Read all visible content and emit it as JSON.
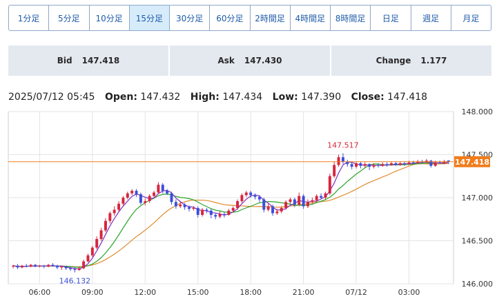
{
  "timeframes": [
    {
      "label": "1分足",
      "active": false
    },
    {
      "label": "5分足",
      "active": false
    },
    {
      "label": "10分足",
      "active": false
    },
    {
      "label": "15分足",
      "active": true
    },
    {
      "label": "30分足",
      "active": false
    },
    {
      "label": "60分足",
      "active": false
    },
    {
      "label": "2時間足",
      "active": false
    },
    {
      "label": "4時間足",
      "active": false
    },
    {
      "label": "8時間足",
      "active": false
    },
    {
      "label": "日足",
      "active": false
    },
    {
      "label": "週足",
      "active": false
    },
    {
      "label": "月足",
      "active": false
    }
  ],
  "quote": {
    "bid_label": "Bid",
    "bid_value": "147.418",
    "ask_label": "Ask",
    "ask_value": "147.430",
    "change_label": "Change",
    "change_value": "1.177"
  },
  "ohlc": {
    "datetime": "2025/07/12 05:45",
    "open_label": "Open:",
    "open": "147.432",
    "high_label": "High:",
    "high": "147.434",
    "low_label": "Low:",
    "low": "147.390",
    "close_label": "Close:",
    "close": "147.418"
  },
  "colors": {
    "up": "#d7263d",
    "down": "#3b4fd8",
    "ma_fast": "#7b2fbf",
    "ma_mid": "#2aa52a",
    "ma_slow": "#e0892b",
    "current_price_bg": "#f07d1c",
    "grid": "#e3e3e3"
  },
  "chart_data": {
    "type": "candlestick",
    "ylim": [
      146.0,
      148.0
    ],
    "y_ticks": [
      "148.000",
      "147.500",
      "147.000",
      "146.500",
      "146.000"
    ],
    "y_tick_values": [
      148.0,
      147.5,
      147.0,
      146.5,
      146.0
    ],
    "x_ticks": [
      "06:00",
      "09:00",
      "12:00",
      "15:00",
      "18:00",
      "21:00",
      "07/12",
      "03:00"
    ],
    "x_tick_index": [
      6,
      18,
      30,
      42,
      54,
      66,
      78,
      90
    ],
    "current_price": 147.418,
    "current_price_label": "147.418",
    "annotations": [
      {
        "text": "147.517",
        "index": 75,
        "value": 147.517,
        "pos": "above"
      },
      {
        "text": "146.132",
        "index": 14,
        "value": 146.132,
        "pos": "below"
      }
    ],
    "candles": [
      [
        146.2,
        146.21,
        146.22,
        146.18
      ],
      [
        146.21,
        146.19,
        146.23,
        146.17
      ],
      [
        146.19,
        146.21,
        146.22,
        146.18
      ],
      [
        146.21,
        146.2,
        146.23,
        146.19
      ],
      [
        146.2,
        146.22,
        146.23,
        146.19
      ],
      [
        146.22,
        146.2,
        146.23,
        146.19
      ],
      [
        146.2,
        146.21,
        146.22,
        146.19
      ],
      [
        146.21,
        146.2,
        146.22,
        146.18
      ],
      [
        146.2,
        146.22,
        146.23,
        146.19
      ],
      [
        146.22,
        146.21,
        146.24,
        146.2
      ],
      [
        146.21,
        146.19,
        146.22,
        146.17
      ],
      [
        146.19,
        146.2,
        146.21,
        146.16
      ],
      [
        146.2,
        146.18,
        146.21,
        146.16
      ],
      [
        146.18,
        146.17,
        146.2,
        146.15
      ],
      [
        146.17,
        146.16,
        146.19,
        146.132
      ],
      [
        146.16,
        146.18,
        146.2,
        146.15
      ],
      [
        146.18,
        146.26,
        146.28,
        146.17
      ],
      [
        146.26,
        146.33,
        146.35,
        146.25
      ],
      [
        146.33,
        146.42,
        146.44,
        146.31
      ],
      [
        146.42,
        146.52,
        146.55,
        146.4
      ],
      [
        146.52,
        146.62,
        146.65,
        146.5
      ],
      [
        146.62,
        146.73,
        146.76,
        146.6
      ],
      [
        146.73,
        146.82,
        146.84,
        146.7
      ],
      [
        146.82,
        146.86,
        146.9,
        146.79
      ],
      [
        146.86,
        146.93,
        146.96,
        146.84
      ],
      [
        146.93,
        147.0,
        147.02,
        146.91
      ],
      [
        147.0,
        147.05,
        147.07,
        146.98
      ],
      [
        147.05,
        147.08,
        147.1,
        147.03
      ],
      [
        147.08,
        147.04,
        147.1,
        147.01
      ],
      [
        147.04,
        146.94,
        147.06,
        146.92
      ],
      [
        146.94,
        146.96,
        146.99,
        146.91
      ],
      [
        146.96,
        147.02,
        147.04,
        146.94
      ],
      [
        147.02,
        147.06,
        147.08,
        147.0
      ],
      [
        147.06,
        147.15,
        147.18,
        147.04
      ],
      [
        147.15,
        147.08,
        147.17,
        147.05
      ],
      [
        147.08,
        147.05,
        147.1,
        147.03
      ],
      [
        147.05,
        146.95,
        147.07,
        146.92
      ],
      [
        146.95,
        146.9,
        146.98,
        146.87
      ],
      [
        146.9,
        146.92,
        146.95,
        146.88
      ],
      [
        146.92,
        146.89,
        146.94,
        146.86
      ],
      [
        146.89,
        146.87,
        146.91,
        146.84
      ],
      [
        146.87,
        146.88,
        146.9,
        146.85
      ],
      [
        146.88,
        146.8,
        146.9,
        146.77
      ],
      [
        146.8,
        146.86,
        146.88,
        146.78
      ],
      [
        146.86,
        146.85,
        146.88,
        146.82
      ],
      [
        146.85,
        146.8,
        146.87,
        146.76
      ],
      [
        146.8,
        146.78,
        146.82,
        146.75
      ],
      [
        146.78,
        146.81,
        146.84,
        146.76
      ],
      [
        146.81,
        146.8,
        146.83,
        146.77
      ],
      [
        146.8,
        146.85,
        146.87,
        146.79
      ],
      [
        146.85,
        146.88,
        146.9,
        146.83
      ],
      [
        146.88,
        146.96,
        146.98,
        146.86
      ],
      [
        146.96,
        147.03,
        147.05,
        146.94
      ],
      [
        147.03,
        147.06,
        147.08,
        147.01
      ],
      [
        147.06,
        147.03,
        147.08,
        147.0
      ],
      [
        147.03,
        147.01,
        147.05,
        146.98
      ],
      [
        147.01,
        146.98,
        147.03,
        146.95
      ],
      [
        146.98,
        146.86,
        147.0,
        146.83
      ],
      [
        146.86,
        146.9,
        146.93,
        146.84
      ],
      [
        146.9,
        146.82,
        146.92,
        146.79
      ],
      [
        146.82,
        146.84,
        146.87,
        146.8
      ],
      [
        146.84,
        146.88,
        146.9,
        146.82
      ],
      [
        146.88,
        146.95,
        146.97,
        146.86
      ],
      [
        146.95,
        146.98,
        147.0,
        146.93
      ],
      [
        146.98,
        146.92,
        147.0,
        146.89
      ],
      [
        146.92,
        147.02,
        147.06,
        146.9
      ],
      [
        147.02,
        146.9,
        147.04,
        146.87
      ],
      [
        146.9,
        146.95,
        146.98,
        146.88
      ],
      [
        146.95,
        146.97,
        147.0,
        146.93
      ],
      [
        146.97,
        147.02,
        147.04,
        146.95
      ],
      [
        147.02,
        147.0,
        147.05,
        146.98
      ],
      [
        147.0,
        147.05,
        147.07,
        146.98
      ],
      [
        147.05,
        147.25,
        147.28,
        147.03
      ],
      [
        147.25,
        147.38,
        147.42,
        147.23
      ],
      [
        147.38,
        147.47,
        147.5,
        147.36
      ],
      [
        147.47,
        147.42,
        147.517,
        147.39
      ],
      [
        147.42,
        147.39,
        147.44,
        147.36
      ],
      [
        147.39,
        147.36,
        147.42,
        147.33
      ],
      [
        147.36,
        147.4,
        147.42,
        147.34
      ],
      [
        147.4,
        147.37,
        147.42,
        147.34
      ],
      [
        147.37,
        147.39,
        147.41,
        147.35
      ],
      [
        147.39,
        147.36,
        147.4,
        147.32
      ],
      [
        147.36,
        147.38,
        147.4,
        147.34
      ],
      [
        147.38,
        147.37,
        147.4,
        147.35
      ],
      [
        147.37,
        147.39,
        147.41,
        147.36
      ],
      [
        147.39,
        147.38,
        147.41,
        147.36
      ],
      [
        147.38,
        147.4,
        147.42,
        147.37
      ],
      [
        147.4,
        147.38,
        147.42,
        147.37
      ],
      [
        147.38,
        147.4,
        147.42,
        147.37
      ],
      [
        147.4,
        147.39,
        147.42,
        147.37
      ],
      [
        147.39,
        147.41,
        147.43,
        147.38
      ],
      [
        147.41,
        147.4,
        147.43,
        147.39
      ],
      [
        147.4,
        147.42,
        147.44,
        147.39
      ],
      [
        147.42,
        147.41,
        147.44,
        147.4
      ],
      [
        147.41,
        147.43,
        147.45,
        147.4
      ],
      [
        147.43,
        147.37,
        147.44,
        147.35
      ],
      [
        147.37,
        147.41,
        147.43,
        147.36
      ],
      [
        147.41,
        147.4,
        147.43,
        147.39
      ],
      [
        147.4,
        147.42,
        147.44,
        147.39
      ],
      [
        147.432,
        147.418,
        147.434,
        147.39
      ]
    ]
  }
}
